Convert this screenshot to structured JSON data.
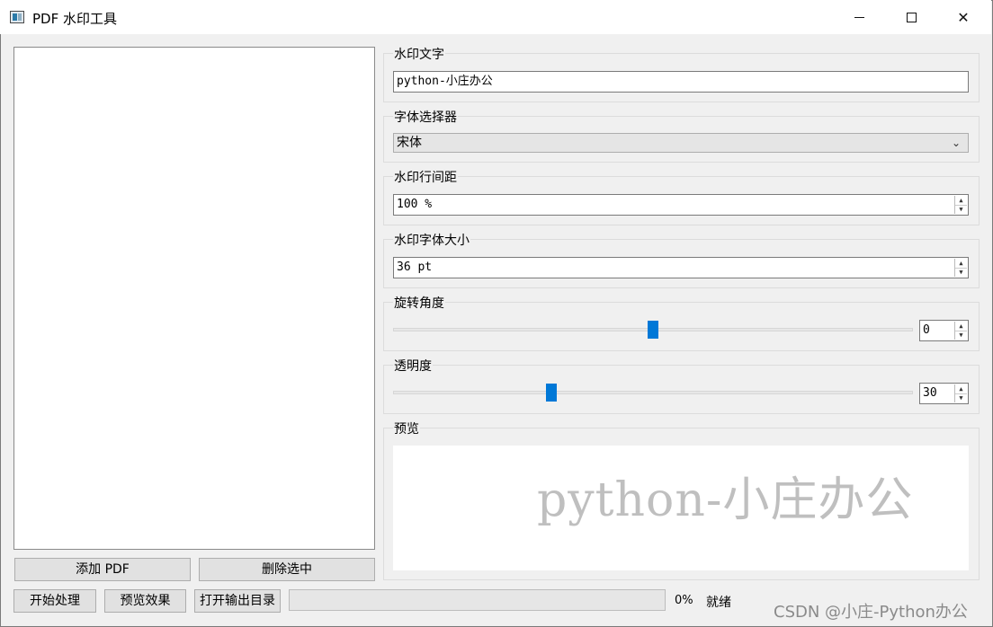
{
  "window": {
    "title": "PDF 水印工具",
    "minimize": "—",
    "maximize": "☐",
    "close": "✕"
  },
  "file_panel": {
    "add_pdf": "添加 PDF",
    "delete_selected": "删除选中"
  },
  "watermark_text": {
    "label": "水印文字",
    "value": "python-小庄办公"
  },
  "font_selector": {
    "label": "字体选择器",
    "value": "宋体"
  },
  "line_spacing": {
    "label": "水印行间距",
    "value": "100 %"
  },
  "font_size": {
    "label": "水印字体大小",
    "value": "36 pt"
  },
  "rotation": {
    "label": "旋转角度",
    "value": "0",
    "slider_fraction": 0.5
  },
  "opacity": {
    "label": "透明度",
    "value": "30",
    "slider_fraction": 0.3
  },
  "preview": {
    "label": "预览",
    "text": "python-小庄办公"
  },
  "bottom_bar": {
    "start": "开始处理",
    "preview_effect": "预览效果",
    "open_output": "打开输出目录",
    "progress_percent": "0%",
    "status": "就绪"
  },
  "overlay_watermark": "CSDN @小庄-Python办公",
  "colors": {
    "accent": "#0078d7",
    "preview_text": "#bfbfbf"
  }
}
